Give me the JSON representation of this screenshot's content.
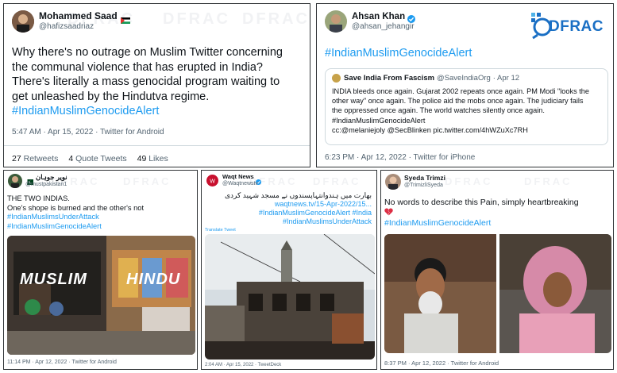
{
  "tweet1": {
    "name": "Mohammed Saad",
    "flag_icon": "palestine-flag-icon",
    "handle": "@hafizsaadriaz",
    "line1": "Why there's no outrage on Muslim Twitter concerning",
    "line2": "the communal violence that has erupted in India?",
    "line3": "There's literally a mass genocidal program waiting to",
    "line4": "get unleashed by the Hindutva regime.",
    "hashtag": "#IndianMuslimGenocideAlert",
    "timestamp": "5:47 AM · Apr 15, 2022 · Twitter for Android",
    "retweets_count": "27",
    "retweets_label": "Retweets",
    "quotes_count": "4",
    "quotes_label": "Quote Tweets",
    "likes_count": "49",
    "likes_label": "Likes"
  },
  "tweet2": {
    "name": "Ahsan Khan",
    "verified_icon": "verified-badge-icon",
    "handle": "@ahsan_jehangir",
    "hashtag": "#IndianMuslimGenocideAlert",
    "quoted": {
      "name": "Save India From Fascism",
      "handle": "@SaveIndiaOrg",
      "date": "· Apr 12",
      "line1": "INDIA bleeds once again. Gujarat 2002 repeats once again. PM Modi \"looks the",
      "line2": "other way\" once again. The police aid the mobs once again. The judiciary fails",
      "line3": "the oppressed once again. The world watches silently once again.",
      "line4": "#IndianMuslimGenocideAlert",
      "line5": "cc:@melaniejoly @SecBlinken pic.twitter.com/4hWZuXc7RH"
    },
    "timestamp": "6:23 PM · Apr 12, 2022 · Twitter for iPhone"
  },
  "logo": {
    "text": "DFRAC",
    "accent": "#1a6fc4"
  },
  "tweet3": {
    "name": "نویر جوہان",
    "handle": "@mustpakistan1",
    "line1": "THE TWO INDIAS.",
    "line2": "One's shope is burned and the other's not",
    "hashtag1": "#IndianMuslimsUnderAttack",
    "hashtag2": "#IndianMuslimGenocideAlert",
    "image_word_left": "MUSLIM",
    "image_word_right": "HINDU",
    "timestamp": "11:14 PM · Apr 12, 2022 · Twitter for Android"
  },
  "tweet4": {
    "name": "Waqt News",
    "handle": "@Waqtnewstv",
    "urdu": "بھارت میں ہندوانتہاپسندوں نے مسجد شہید کردی",
    "link": "waqtnews.tv/15-Apr-2022/15...",
    "hashtag1": "#IndianMuslimGenocideAlert #India",
    "hashtag2": "#IndianMuslimsUnderAttack",
    "translate": "Translate Tweet",
    "timestamp": "2:04 AM · Apr 15, 2022 · TweetDeck"
  },
  "tweet5": {
    "name": "Syeda Trimzi",
    "handle": "@TrimizliSyeda",
    "line1": "No words to describe this Pain, simply heartbreaking",
    "heart_icon": "broken-heart-icon",
    "hashtag": "#IndianMuslimGenocideAlert",
    "timestamp": "8:37 PM · Apr 12, 2022 · Twitter for Android"
  },
  "watermark": "DFRAC",
  "colors": {
    "link": "#1d9bf0",
    "muted": "#536471",
    "text": "#0f1419",
    "border": "#2f3336"
  }
}
